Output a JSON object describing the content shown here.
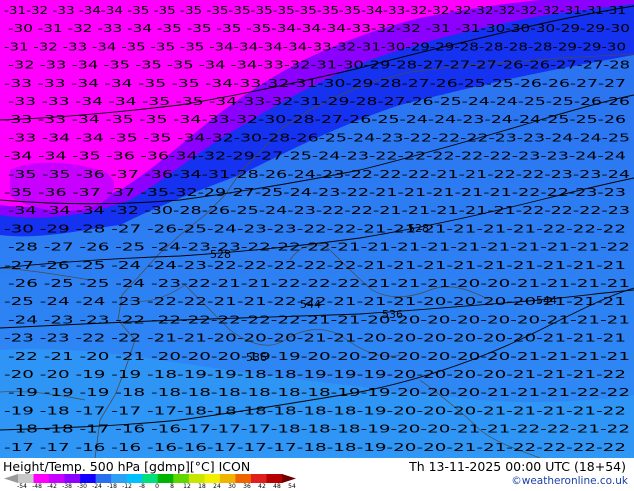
{
  "map": {
    "title": "Height/Temp. 500 hPa [gdmp][°C] ICON",
    "valid_time": "Th 13-11-2025 00:00 UTC (18+54)",
    "credit": "©weatheronline.co.uk",
    "height_contour_labels": [
      "528",
      "528",
      "536",
      "536",
      "544",
      "544"
    ],
    "temperature_rows": [
      "-31-32 -33 -34-34 -35 -35 -35 -35-35-35-35-35-35-35-34-33-32-32-32-32-32-32-32-31-31-31",
      "-30 -31 -32 -33 -34 -35 -35 -35 -35-34-34-34-33-32-32 -31 -31-30-30-30-29-29-30",
      "-31 -32 -33 -34 -35 -35 -35 -34-34-34-34-33-32-31-30-29-29-28-28-28-28-29-29-30",
      "-32 -33 -34 -35 -35 -35 -34 -34-33-32-31-30-29-28-27-27-27-26-26-27-27-28",
      "-33 -33 -34 -34 -35 -35 -34-33-32-31-30-29-28-27-26-25-25-26-26-27-27",
      "-33 -33 -34 -34 -35 -35 -34-33-32-31-29-28-27-26-25-24-24-25-25-26-26",
      "-33 -33 -34 -35 -35 -34-33-32-30-28-27-26-25-24-24-23-24-24-25-25-26",
      "-33 -34 -34 -35 -35 -34-32-30-28-26-25-24-23-22-22-22-23-23-24-24-25",
      "-34 -34 -35 -36 -36-34-32-29-27-25-24-23-22-22-22-22-22-23-23-24-24",
      "-35 -35 -36 -37 -36-34-31-28-26-24-23-22-22-22-21-21-22-22-23-23-24",
      "-35 -36 -37 -37 -35-32-29-27-25-24-23-22-21-21-21-21-21-22-22-23-23",
      "-34 -34 -34 -32 -30-28-26-25-24-23-22-22-21-21-21-21-21-22-22-22-23",
      "-30 -29 -28 -27 -26-25-24-23-23-22-22-21-21-21-21-21-21-22-22-22",
      "-28 -27 -26 -25 -24-23-23-22-22-22-21-21-21-21-21-21-21-21-21-22",
      "-27 -26 -25 -24 -24-23-22-22-22-22-22-21-21-21-21-21-21-21-21-21",
      "-26 -25 -25 -24 -23-22-21-21-22-22-22-21-21-21-20-20-21-21-21-21",
      "-25 -24 -24 -23 -22-22-21-21-22-22-21-21-21-20-20-20-20-21-21-21",
      "-24 -23 -23 -22 -22-22-22-22-22-21-21-20-20-20-20-20-20-21-21-21",
      "-23 -23 -22 -22 -21-21-20-20-20-21-21-20-20-20-20-20-20-21-21-21",
      "-22 -21 -20 -21 -20-20-20-19-19-20-20-20-20-20-20-20-21-21-21-21",
      "-20 -20 -19 -19 -18-19-19-18-18-19-19-19-20-20-20-20-21-21-21-22",
      "-19 -19 -19 -18 -18-18-18-18-18-18-19-19-20-20-20-21-21-21-22-22",
      "-19 -18 -17 -17 -17-18-18-18-18-18-18-19-20-20-20-21-21-21-21-22",
      "-18 -18 -17 -16 -16-17-17-17-18-18-18-19-20-20-21-21-22-22-21-22",
      "-17 -17 -16 -16 -16-16-17-17-17-18-18-19-20-20-21-21-22-22-22-22"
    ],
    "legend": {
      "labels": [
        "-54",
        "-48",
        "-42",
        "-38",
        "-30",
        "-24",
        "-18",
        "-12",
        "-8",
        "0",
        "8",
        "12",
        "18",
        "24",
        "30",
        "36",
        "42",
        "48",
        "54"
      ],
      "colors": [
        "#9a9a9a",
        "#c8c8c8",
        "#ff00ff",
        "#c800ff",
        "#8c00ff",
        "#1400ff",
        "#2a6ff0",
        "#2da0f5",
        "#00c0ff",
        "#00e07a",
        "#00b400",
        "#60d800",
        "#c8e600",
        "#f0f000",
        "#f0b400",
        "#f06400",
        "#e01e1e",
        "#b40000",
        "#6e0000"
      ]
    }
  }
}
